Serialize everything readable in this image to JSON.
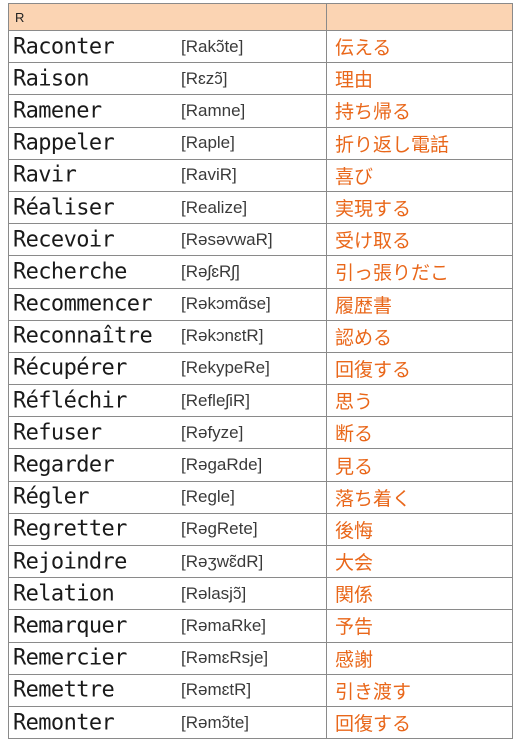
{
  "header": {
    "letter": "R"
  },
  "rows": [
    {
      "word": "Raconter",
      "pron": "[Rakɔ̃te]",
      "meaning": "伝える"
    },
    {
      "word": "Raison",
      "pron": "[Rɛzɔ̃]",
      "meaning": "理由"
    },
    {
      "word": "Ramener",
      "pron": "[Ramne]",
      "meaning": "持ち帰る"
    },
    {
      "word": "Rappeler",
      "pron": "[Raple]",
      "meaning": "折り返し電話"
    },
    {
      "word": "Ravir",
      "pron": "[RaviR]",
      "meaning": "喜び"
    },
    {
      "word": "Réaliser",
      "pron": "[Realize]",
      "meaning": "実現する"
    },
    {
      "word": "Recevoir",
      "pron": "[RəsəvwaR]",
      "meaning": "受け取る"
    },
    {
      "word": "Recherche",
      "pron": "[RəʃɛRʃ]",
      "meaning": "引っ張りだこ"
    },
    {
      "word": "Recommencer",
      "pron": "[Rəkɔmɑ̃se]",
      "meaning": "履歴書"
    },
    {
      "word": "Reconnaître",
      "pron": "[RəkɔnɛtR]",
      "meaning": "認める"
    },
    {
      "word": "Récupérer",
      "pron": "[RekypeRe]",
      "meaning": "回復する"
    },
    {
      "word": "Réfléchir",
      "pron": "[RefleʃiR]",
      "meaning": "思う"
    },
    {
      "word": "Refuser",
      "pron": "[Rəfyze]",
      "meaning": "断る"
    },
    {
      "word": "Regarder",
      "pron": "[RəgaRde]",
      "meaning": "見る"
    },
    {
      "word": "Régler",
      "pron": "[Regle]",
      "meaning": "落ち着く"
    },
    {
      "word": "Regretter",
      "pron": "[RəgRete]",
      "meaning": "後悔"
    },
    {
      "word": "Rejoindre",
      "pron": "[Rəʒwɛ̃dR]",
      "meaning": "大会"
    },
    {
      "word": "Relation",
      "pron": "[Rəlasjɔ̃]",
      "meaning": "関係"
    },
    {
      "word": "Remarquer",
      "pron": "[RəmaRke]",
      "meaning": "予告"
    },
    {
      "word": "Remercier",
      "pron": "[RəmɛRsje]",
      "meaning": "感謝"
    },
    {
      "word": "Remettre",
      "pron": "[RəmɛtR]",
      "meaning": "引き渡す"
    },
    {
      "word": "Remonter",
      "pron": "[Rəmɔ̃te]",
      "meaning": "回復する"
    }
  ]
}
